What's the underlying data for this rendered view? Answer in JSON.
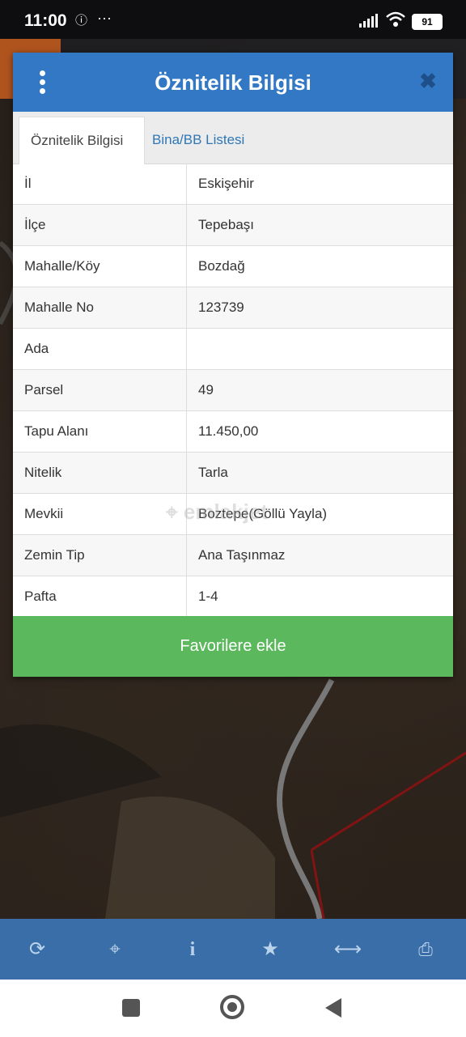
{
  "status": {
    "time": "11:00",
    "battery": "91"
  },
  "modal": {
    "title": "Öznitelik Bilgisi",
    "tabs": [
      {
        "label": "Öznitelik Bilgisi",
        "active": true
      },
      {
        "label": "Bina/BB Listesi",
        "active": false
      }
    ],
    "rows": [
      {
        "key": "İl",
        "value": "Eskişehir"
      },
      {
        "key": "İlçe",
        "value": "Tepebaşı"
      },
      {
        "key": "Mahalle/Köy",
        "value": "Bozdağ"
      },
      {
        "key": "Mahalle No",
        "value": "123739"
      },
      {
        "key": "Ada",
        "value": ""
      },
      {
        "key": "Parsel",
        "value": "49"
      },
      {
        "key": "Tapu Alanı",
        "value": "11.450,00"
      },
      {
        "key": "Nitelik",
        "value": "Tarla"
      },
      {
        "key": "Mevkii",
        "value": "Boztepe(Göllü Yayla)"
      },
      {
        "key": "Zemin Tip",
        "value": "Ana Taşınmaz"
      },
      {
        "key": "Pafta",
        "value": "1-4"
      }
    ],
    "favorite_button": "Favorilere ekle"
  },
  "watermark": "emlakjet",
  "toolbar": {
    "icons": [
      "refresh-icon",
      "locate-icon",
      "info-icon",
      "star-icon",
      "measure-icon",
      "print-icon"
    ]
  },
  "colors": {
    "header": "#3278c4",
    "button": "#5cb85c",
    "toolbar": "#3a6ea8",
    "tab_link": "#2f77b5"
  }
}
